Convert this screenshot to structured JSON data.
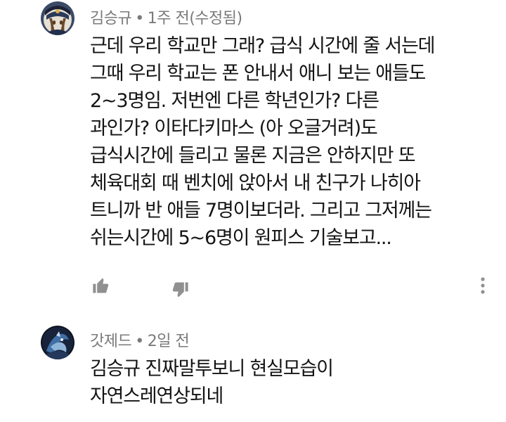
{
  "comments": [
    {
      "author": "김승규",
      "separator": "•",
      "time": "1주 전(수정됨)",
      "text_lines": [
        "근데 우리 학교만 그래? 급식 시간에 줄 서는데",
        "그때 우리 학교는 폰 안내서 애니 보는 애들도",
        "2~3명임. 저번엔 다른 학년인가? 다른",
        "과인가? 이타다키마스 (아 오글거려)도",
        "급식시간에 들리고 물론 지금은 안하지만 또",
        "체육대회 때 벤치에 앉아서 내 친구가 나히아",
        "트니까 반 애들 7명이보더라. 그리고 그저께는",
        "쉬는시간에 5~6명이 원피스 기술보고..."
      ],
      "icons": {
        "like": "thumbs-up-icon",
        "dislike": "thumbs-down-icon",
        "more": "more-vertical-icon"
      }
    },
    {
      "author": "갓제드",
      "separator": "•",
      "time": "2일 전",
      "text_lines": [
        "김승규 진짜말투보니 현실모습이",
        "자연스레연상되네"
      ]
    }
  ],
  "colors": {
    "meta": "#7a7a7a",
    "text": "#141414",
    "icon": "#909090"
  }
}
